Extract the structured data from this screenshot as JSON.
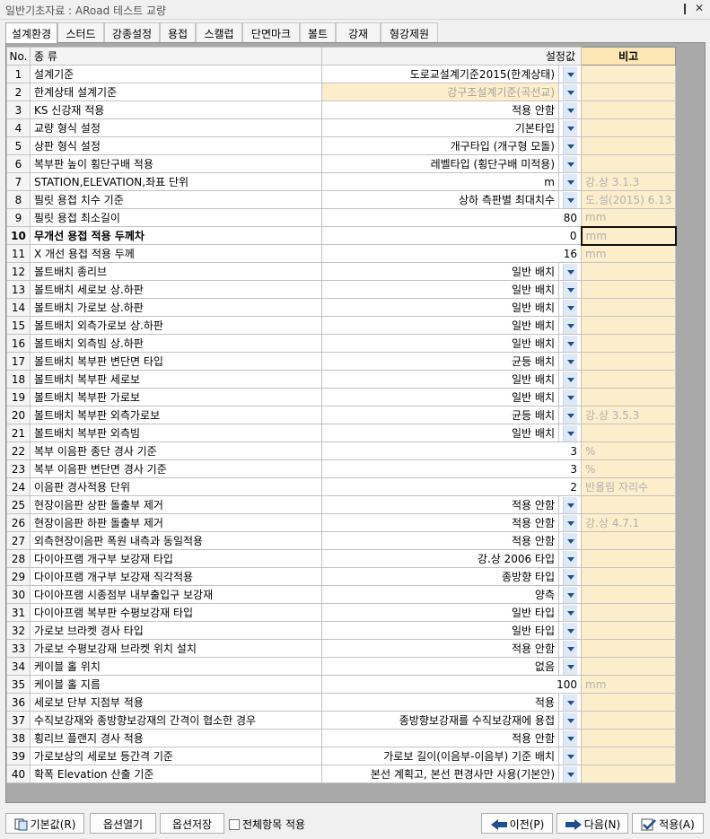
{
  "window": {
    "title": "일반기초자료 : ARoad 테스트 교량",
    "pin_glyph": "❙",
    "close_glyph": "✕"
  },
  "tabs": [
    "설계환경",
    "스터드",
    "강종설정",
    "용접",
    "스캘럽",
    "단면마크",
    "볼트",
    "강재",
    "형강제원"
  ],
  "grid": {
    "headers": {
      "no": "No.",
      "name": "종 류",
      "value": "설정값",
      "note": "비고"
    },
    "rows": [
      {
        "no": "1",
        "name": "설계기준",
        "value": "도로교설계기준2015(한계상태)",
        "dropdown": true,
        "note": ""
      },
      {
        "no": "2",
        "name": "한계상태 설계기준",
        "value": "강구조설계기준(곡선교)",
        "dropdown": true,
        "note": "",
        "muted": true
      },
      {
        "no": "3",
        "name": "KS 신강재 적용",
        "value": "적용 안함",
        "dropdown": true,
        "note": ""
      },
      {
        "no": "4",
        "name": "교량 형식 설정",
        "value": "기본타입",
        "dropdown": true,
        "note": ""
      },
      {
        "no": "5",
        "name": "상판 형식 설정",
        "value": "개구타입 (개구형 모돌)",
        "dropdown": true,
        "note": ""
      },
      {
        "no": "6",
        "name": "복부판 높이 횡단구배 적용",
        "value": "레벨타입 (횡단구배 미적용)",
        "dropdown": true,
        "note": ""
      },
      {
        "no": "7",
        "name": "STATION,ELEVATION,좌표 단위",
        "value": "m",
        "dropdown": true,
        "note": "강.상 3.1.3"
      },
      {
        "no": "8",
        "name": "필릿 용접 치수 기준",
        "value": "상하 측판별 최대치수",
        "dropdown": true,
        "note": "도.설(2015) 6.13"
      },
      {
        "no": "9",
        "name": "필릿 용접 최소길이",
        "value": "80",
        "dropdown": false,
        "note": "mm"
      },
      {
        "no": "10",
        "name": "무개선 용접 적용 두께차",
        "value": "0",
        "dropdown": false,
        "note": "mm",
        "selected": true
      },
      {
        "no": "11",
        "name": "X 개선 용접 적용 두께",
        "value": "16",
        "dropdown": false,
        "note": "mm"
      },
      {
        "no": "12",
        "name": "볼트배치 종리브",
        "value": "일반 배치",
        "dropdown": true,
        "note": ""
      },
      {
        "no": "13",
        "name": "볼트배치 세로보 상.하판",
        "value": "일반 배치",
        "dropdown": true,
        "note": ""
      },
      {
        "no": "14",
        "name": "볼트배치 가로보 상.하판",
        "value": "일반 배치",
        "dropdown": true,
        "note": ""
      },
      {
        "no": "15",
        "name": "볼트배치 외측가로보 상.하판",
        "value": "일반 배치",
        "dropdown": true,
        "note": ""
      },
      {
        "no": "16",
        "name": "볼트배치 외측빔 상.하판",
        "value": "일반 배치",
        "dropdown": true,
        "note": ""
      },
      {
        "no": "17",
        "name": "볼트배치 복부판 변단면 타입",
        "value": "균등 배치",
        "dropdown": true,
        "note": ""
      },
      {
        "no": "18",
        "name": "볼트배치 복부판 세로보",
        "value": "일반 배치",
        "dropdown": true,
        "note": ""
      },
      {
        "no": "19",
        "name": "볼트배치 복부판 가로보",
        "value": "일반 배치",
        "dropdown": true,
        "note": ""
      },
      {
        "no": "20",
        "name": "볼트배치 복부판 외측가로보",
        "value": "균등 배치",
        "dropdown": true,
        "note": "강.상 3.5.3"
      },
      {
        "no": "21",
        "name": "볼트배치 복부판 외측빔",
        "value": "일반 배치",
        "dropdown": true,
        "note": ""
      },
      {
        "no": "22",
        "name": "복부 이음판 종단 경사 기준",
        "value": "3",
        "dropdown": false,
        "note": "%"
      },
      {
        "no": "23",
        "name": "복부 이음판 변단면 경사 기준",
        "value": "3",
        "dropdown": false,
        "note": "%"
      },
      {
        "no": "24",
        "name": "이음판 경사적용 단위",
        "value": "2",
        "dropdown": false,
        "note": "반올림 자리수"
      },
      {
        "no": "25",
        "name": "현장이음판 상판 돌출부 제거",
        "value": "적용 안함",
        "dropdown": true,
        "note": ""
      },
      {
        "no": "26",
        "name": "현장이음판 하판 돌출부 제거",
        "value": "적용 안함",
        "dropdown": true,
        "note": "강.상 4.7.1"
      },
      {
        "no": "27",
        "name": "외측현장이음판 폭원 내측과 동일적용",
        "value": "적용 안함",
        "dropdown": true,
        "note": ""
      },
      {
        "no": "28",
        "name": "다이아프램 개구부 보강재 타입",
        "value": "강.상 2006 타입",
        "dropdown": true,
        "note": ""
      },
      {
        "no": "29",
        "name": "다이아프램 개구부 보강재 직각적용",
        "value": "종방향 타입",
        "dropdown": true,
        "note": ""
      },
      {
        "no": "30",
        "name": "다이아프램 시종점부 내부출입구 보강재",
        "value": "양측",
        "dropdown": true,
        "note": ""
      },
      {
        "no": "31",
        "name": "다이아프램 복부판 수평보강재 타입",
        "value": "일반 타입",
        "dropdown": true,
        "note": ""
      },
      {
        "no": "32",
        "name": "가로보 브라켓 경사 타입",
        "value": "일반 타입",
        "dropdown": true,
        "note": ""
      },
      {
        "no": "33",
        "name": "가로보 수평보강재 브라켓 위치 설치",
        "value": "적용 안함",
        "dropdown": true,
        "note": ""
      },
      {
        "no": "34",
        "name": "케이블 홀 위치",
        "value": "없음",
        "dropdown": true,
        "note": ""
      },
      {
        "no": "35",
        "name": "케이블 홀 지름",
        "value": "100",
        "dropdown": false,
        "note": "mm"
      },
      {
        "no": "36",
        "name": "세로보 단부 지점부 적용",
        "value": "적용",
        "dropdown": true,
        "note": ""
      },
      {
        "no": "37",
        "name": "수직보강재와 종방향보강재의 간격이 협소한 경우",
        "value": "종방향보강재를 수직보강재에 용접",
        "dropdown": true,
        "note": ""
      },
      {
        "no": "38",
        "name": "횡리브 플랜지 경사 적용",
        "value": "적용 안함",
        "dropdown": true,
        "note": ""
      },
      {
        "no": "39",
        "name": "가로보상의 세로보 등간격 기준",
        "value": "가로보 길이(이음부-이음부) 기준 배치",
        "dropdown": true,
        "note": ""
      },
      {
        "no": "40",
        "name": "확폭 Elevation 산출 기준",
        "value": "본선 계획고, 본선 편경사만 사용(기본안)",
        "dropdown": true,
        "note": ""
      }
    ]
  },
  "bottom": {
    "default_label": "기본값(R)",
    "open_label": "옵션열기",
    "save_label": "옵션저장",
    "apply_all_label": "전체항목 적용",
    "apply_all_checked": false,
    "prev_label": "이전(P)",
    "next_label": "다음(N)",
    "apply_label": "적용(A)"
  },
  "colors": {
    "note_bg": "#fdeecb",
    "dropdown_arrow": "#1f4e8c",
    "panel_bg": "#a9a9a9"
  }
}
